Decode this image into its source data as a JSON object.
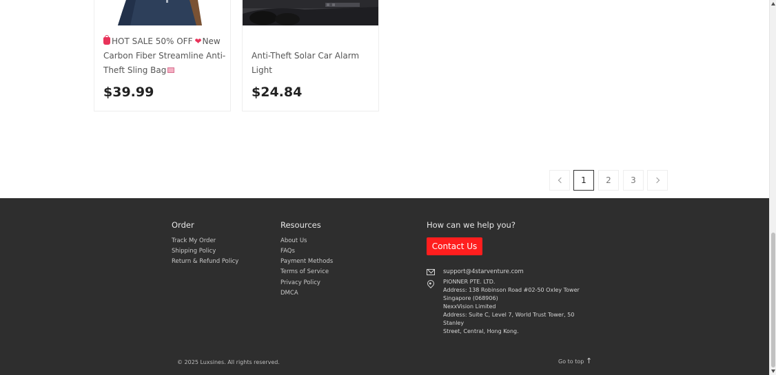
{
  "products": [
    {
      "title_line1_a": "HOT SALE 50% OFF",
      "title_line1_b": "New",
      "title_line2": "Carbon Fiber Streamline Anti-",
      "title_line3": "Theft Sling Bag",
      "price": "$39.99",
      "image_icon": "sling-bag-image"
    },
    {
      "title_line1": "Anti-Theft Solar Car Alarm Light",
      "price": "$24.84",
      "image_icon": "car-dashboard-image"
    }
  ],
  "pagination": {
    "pages": [
      "1",
      "2",
      "3"
    ],
    "current_page": 1
  },
  "footer": {
    "order": {
      "heading": "Order",
      "links": [
        "Track My Order",
        "Shipping Policy",
        "Return & Refund Policy"
      ]
    },
    "resources": {
      "heading": "Resources",
      "links": [
        "About Us",
        "FAQs",
        "Payment Methods",
        "Terms of Service",
        "Privacy Policy",
        "DMCA"
      ]
    },
    "help": {
      "heading": "How can we help you?",
      "contact_button": "Contact Us",
      "email": "support@4starventure.com",
      "address_lines": [
        "PIONNER PTE. LTD.",
        "Address: 138 Robinson Road #02-50 Oxley Tower",
        "Singapore (068906)",
        "NexxVision Limited",
        "Address: Suite C, Level 7, World Trust Tower, 50 Stanley",
        "Street, Central, Hong Kong."
      ]
    },
    "copyright": "© 2025 Luxsines. All rights reserved.",
    "go_to_top": "Go to top"
  },
  "colors": {
    "footer_bg": "#2e2e2e",
    "contact_button": "#ff1e1e"
  }
}
